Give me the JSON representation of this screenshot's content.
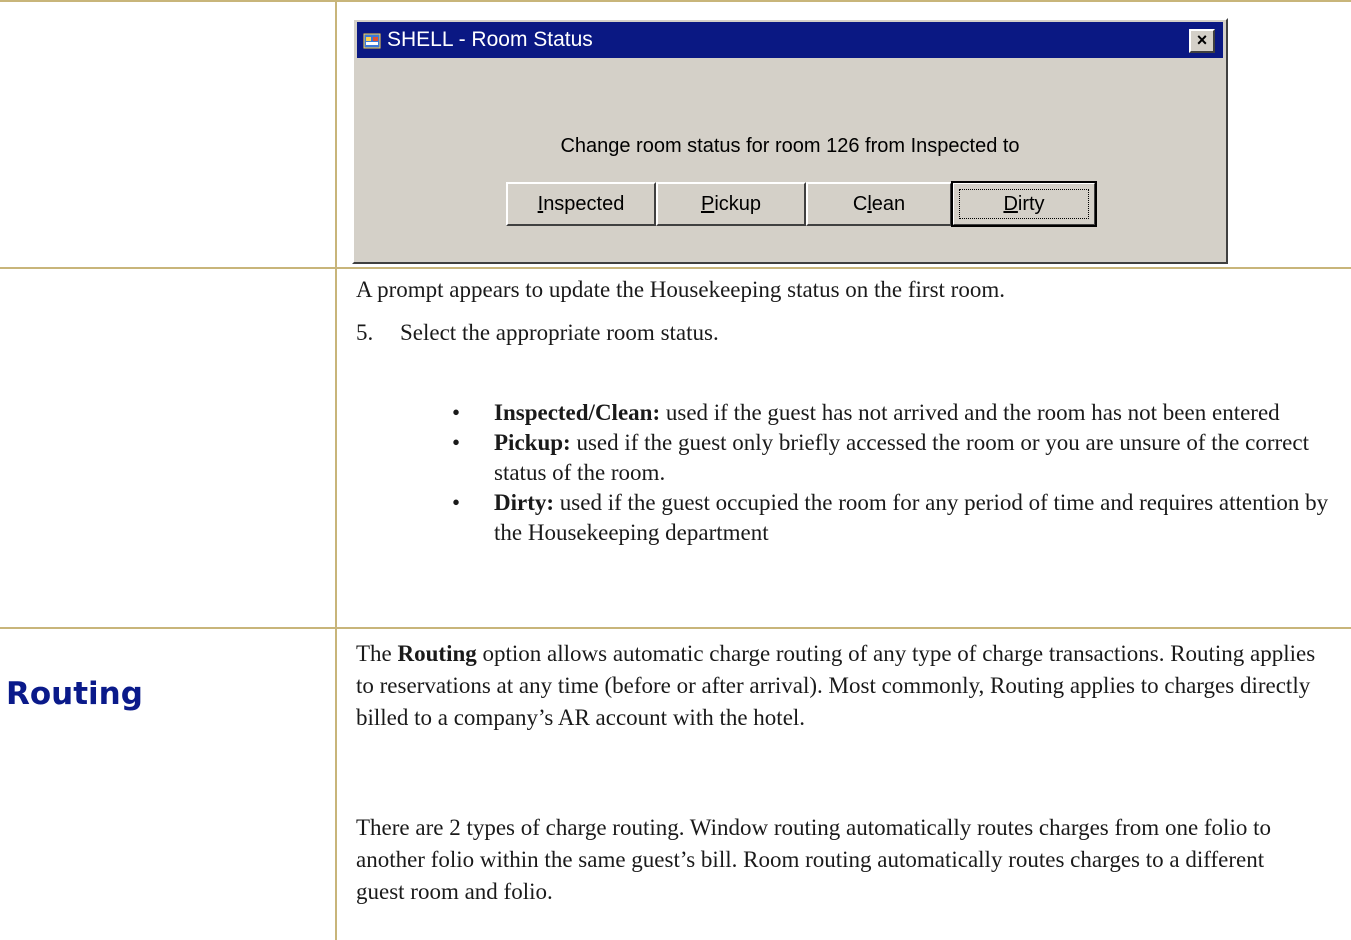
{
  "dialog": {
    "title": "SHELL - Room Status",
    "close_label": "×",
    "prompt": "Change room status for room 126 from Inspected to",
    "buttons": [
      {
        "label": "Inspected",
        "mnemonic": "I"
      },
      {
        "label": "Pickup",
        "mnemonic": "P"
      },
      {
        "label": "Clean",
        "mnemonic": "l"
      },
      {
        "label": "Dirty",
        "mnemonic": "D",
        "default": true
      }
    ]
  },
  "doc": {
    "intro": "A prompt appears to update the Housekeeping status on the first room.",
    "step_number": "5.",
    "step_text": "Select the appropriate room status.",
    "bullets": [
      {
        "term": "Inspected/Clean:",
        "text": " used if the guest has not arrived and the room has not been entered"
      },
      {
        "term": "Pickup:",
        "text": " used if the guest only briefly accessed the room or you are unsure of the correct status of the room."
      },
      {
        "term": "Dirty:",
        "text": " used if the guest occupied the room for any period of time and requires attention by the Housekeeping department"
      }
    ],
    "section_heading": "Routing",
    "routing_p1_pre": "The ",
    "routing_p1_bold": "Routing",
    "routing_p1_post": " option allows automatic charge routing of any type of charge transactions.  Routing applies to reservations at any time (before or after arrival).  Most commonly, Routing applies to charges directly billed to a company’s AR account with the hotel.",
    "routing_p2": "There are 2 types of charge routing.  Window routing automatically routes charges from one folio to another folio within the same guest’s bill.  Room routing automatically routes charges to a different guest room and folio."
  }
}
